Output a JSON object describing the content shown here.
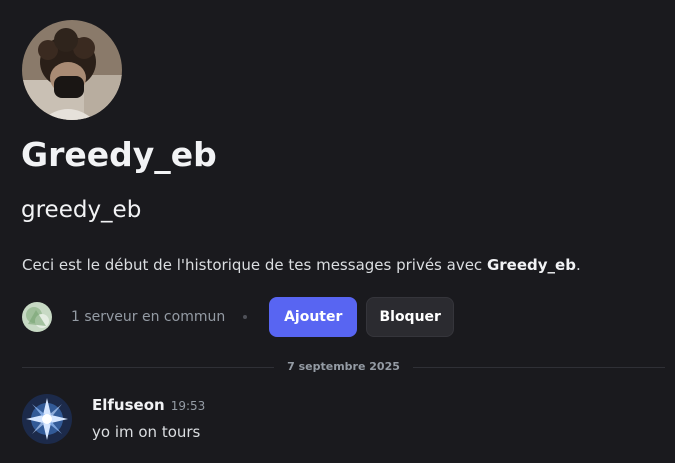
{
  "profile": {
    "display_name": "Greedy_eb",
    "username": "greedy_eb",
    "avatar_icon": "user-avatar-photo"
  },
  "intro": {
    "text": "Ceci est le début de l'historique de tes messages privés avec ",
    "name": "Greedy_eb",
    "suffix": "."
  },
  "mutual": {
    "server_icon": "server-icon",
    "text": "1 serveur en commun"
  },
  "actions": {
    "add_label": "Ajouter",
    "block_label": "Bloquer"
  },
  "divider": {
    "date": "7 septembre 2025"
  },
  "messages": [
    {
      "author": "Elfuseon",
      "time": "19:53",
      "text": "yo im on tours",
      "avatar_icon": "user-avatar"
    }
  ],
  "colors": {
    "background": "#1a1a1e",
    "accent": "#5865f2",
    "secondary_button": "#2b2b30",
    "muted_text": "#949ba4"
  }
}
